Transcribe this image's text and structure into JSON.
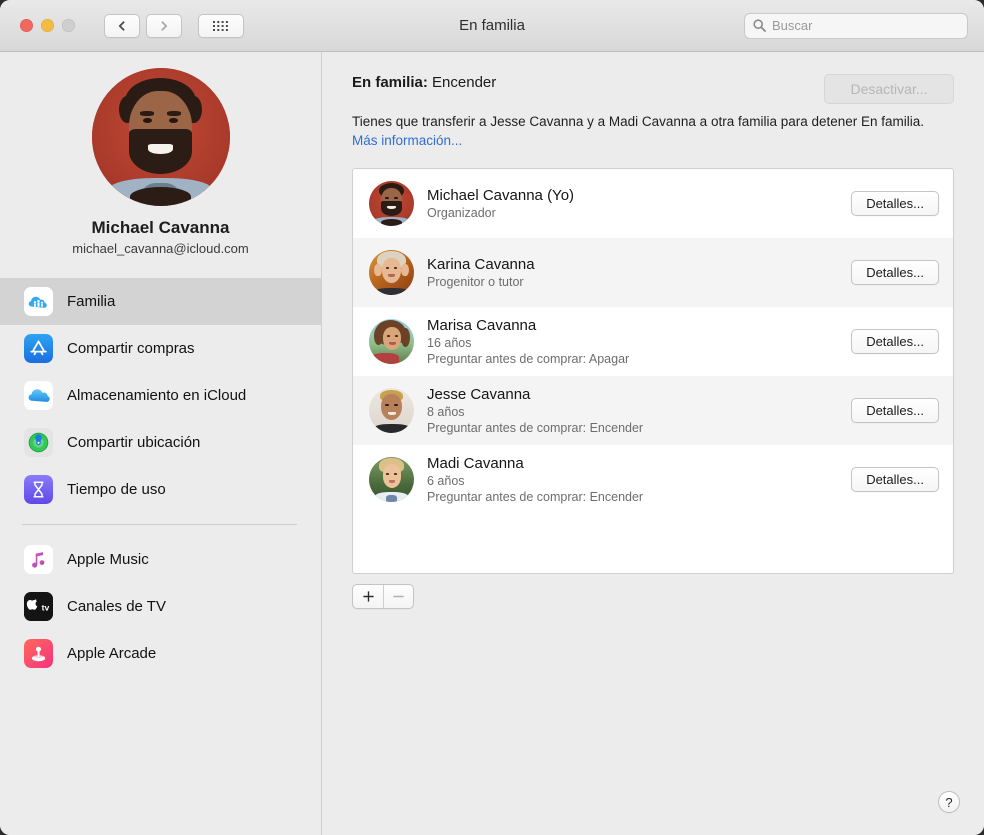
{
  "window": {
    "title": "En familia",
    "traffic_lights": [
      "close",
      "minimize",
      "zoom"
    ],
    "back_label": "Atrás",
    "forward_label": "Adelante",
    "grid_label": "Mostrar todo"
  },
  "search": {
    "placeholder": "Buscar",
    "value": ""
  },
  "sidebar": {
    "profile": {
      "name": "Michael Cavanna",
      "email": "michael_cavanna@icloud.com"
    },
    "items": [
      {
        "label": "Familia",
        "icon": "family-cloud-icon",
        "selected": true
      },
      {
        "label": "Compartir compras",
        "icon": "app-store-icon",
        "selected": false
      },
      {
        "label": "Almacenamiento en iCloud",
        "icon": "icloud-icon",
        "selected": false
      },
      {
        "label": "Compartir ubicación",
        "icon": "find-my-icon",
        "selected": false
      },
      {
        "label": "Tiempo de uso",
        "icon": "screen-time-icon",
        "selected": false
      }
    ],
    "items_secondary": [
      {
        "label": "Apple Music",
        "icon": "apple-music-icon"
      },
      {
        "label": "Canales de TV",
        "icon": "apple-tv-icon"
      },
      {
        "label": "Apple Arcade",
        "icon": "apple-arcade-icon"
      }
    ]
  },
  "main": {
    "status_label": "En familia:",
    "status_value": "Encender",
    "turn_off_button": "Desactivar...",
    "turn_off_disabled": true,
    "description_text": "Tienes que transferir a Jesse Cavanna y a Madi Cavanna a otra familia para detener En familia. ",
    "description_link": "Más información...",
    "details_button": "Detalles...",
    "add_button": "+",
    "remove_button": "—",
    "help_button": "?",
    "members": [
      {
        "name": "Michael Cavanna (Yo)",
        "role": "Organizador",
        "age": "",
        "ask_to_buy": ""
      },
      {
        "name": "Karina Cavanna",
        "role": "Progenitor o tutor",
        "age": "",
        "ask_to_buy": ""
      },
      {
        "name": "Marisa Cavanna",
        "role": "",
        "age": "16 años",
        "ask_to_buy": "Preguntar antes de comprar: Apagar"
      },
      {
        "name": "Jesse Cavanna",
        "role": "",
        "age": "8 años",
        "ask_to_buy": "Preguntar antes de comprar: Encender"
      },
      {
        "name": "Madi Cavanna",
        "role": "",
        "age": "6 años",
        "ask_to_buy": "Preguntar antes de comprar: Encender"
      }
    ]
  },
  "colors": {
    "window_bg": "#ececec",
    "sidebar_selected": "#d3d3d3",
    "link": "#2f6fd0",
    "row_alt": "#f4f4f4",
    "list_bg": "#ffffff",
    "text_primary": "#151515",
    "text_secondary": "#6d6d6d"
  }
}
